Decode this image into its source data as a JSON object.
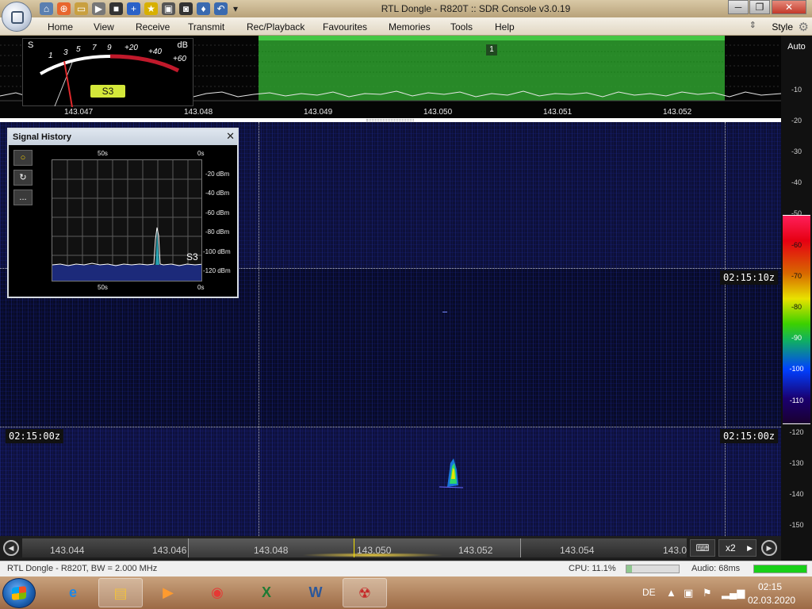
{
  "window": {
    "title": "RTL Dongle - R820T :: SDR Console v3.0.19",
    "minimize": "─",
    "maximize": "❐",
    "close": "✕"
  },
  "menu": {
    "items": [
      "Home",
      "View",
      "Receive",
      "Transmit",
      "Rec/Playback",
      "Favourites",
      "Memories",
      "Tools",
      "Help"
    ],
    "style_label": "Style"
  },
  "smeter": {
    "s_label": "S",
    "db_label": "dB",
    "scale_s": [
      "1",
      "3",
      "5",
      "7",
      "9"
    ],
    "scale_db": [
      "+20",
      "+40",
      "+60"
    ],
    "reading": "S3"
  },
  "spectrum": {
    "freq_ticks": [
      "143.047",
      "143.048",
      "143.049",
      "143.050",
      "143.051",
      "143.052"
    ],
    "marker": "1",
    "passband_color": "#2fa12f"
  },
  "db_scale": {
    "auto": "Auto",
    "ticks": [
      "-10",
      "-20",
      "-30",
      "-40",
      "-50"
    ],
    "colorbar_ticks": [
      "-60",
      "-70",
      "-80",
      "-90",
      "-100",
      "-110"
    ],
    "lower_ticks": [
      "-120",
      "-130",
      "-140",
      "-150"
    ]
  },
  "waterfall": {
    "timestamps": {
      "right_top": "02:15:10z",
      "left_mid": "02:15:00z",
      "right_mid": "02:15:00z"
    }
  },
  "signal_history": {
    "title": "Signal History",
    "close": "✕",
    "tools": [
      "○",
      "↻",
      "..."
    ],
    "top_left": "50s",
    "top_right": "0s",
    "bottom_left": "50s",
    "bottom_right": "0s",
    "levels": [
      "-20 dBm",
      "-40 dBm",
      "-60 dBm",
      "-80 dBm",
      "-100 dBm",
      "-120 dBm"
    ],
    "reading": "S3"
  },
  "freq_strip": {
    "labels": [
      "143.044",
      "143.046",
      "143.048",
      "143.050",
      "143.052",
      "143.054",
      "143.0"
    ],
    "zoom": "x2",
    "keyboard": "⌨",
    "prev": "◀",
    "next": "▶"
  },
  "status": {
    "device": "RTL Dongle - R820T, BW = 2.000 MHz",
    "cpu": "CPU: 11.1%",
    "cpu_percent": 11.1,
    "audio": "Audio: 68ms",
    "audio_level": 1.0
  },
  "taskbar": {
    "language": "DE",
    "time": "02:15",
    "date": "02.03.2020",
    "apps": [
      {
        "name": "Internet Explorer",
        "glyph": "e",
        "color": "#1e88e5"
      },
      {
        "name": "Windows Explorer",
        "glyph": "▤",
        "color": "#f0c040"
      },
      {
        "name": "Media Player",
        "glyph": "▶",
        "color": "#ff9b2f"
      },
      {
        "name": "Chrome",
        "glyph": "◉",
        "color": "#e53935"
      },
      {
        "name": "Excel",
        "glyph": "X",
        "color": "#1e7b34"
      },
      {
        "name": "Word",
        "glyph": "W",
        "color": "#2b579a"
      },
      {
        "name": "SDR Console",
        "glyph": "☢",
        "color": "#c62828"
      }
    ]
  }
}
